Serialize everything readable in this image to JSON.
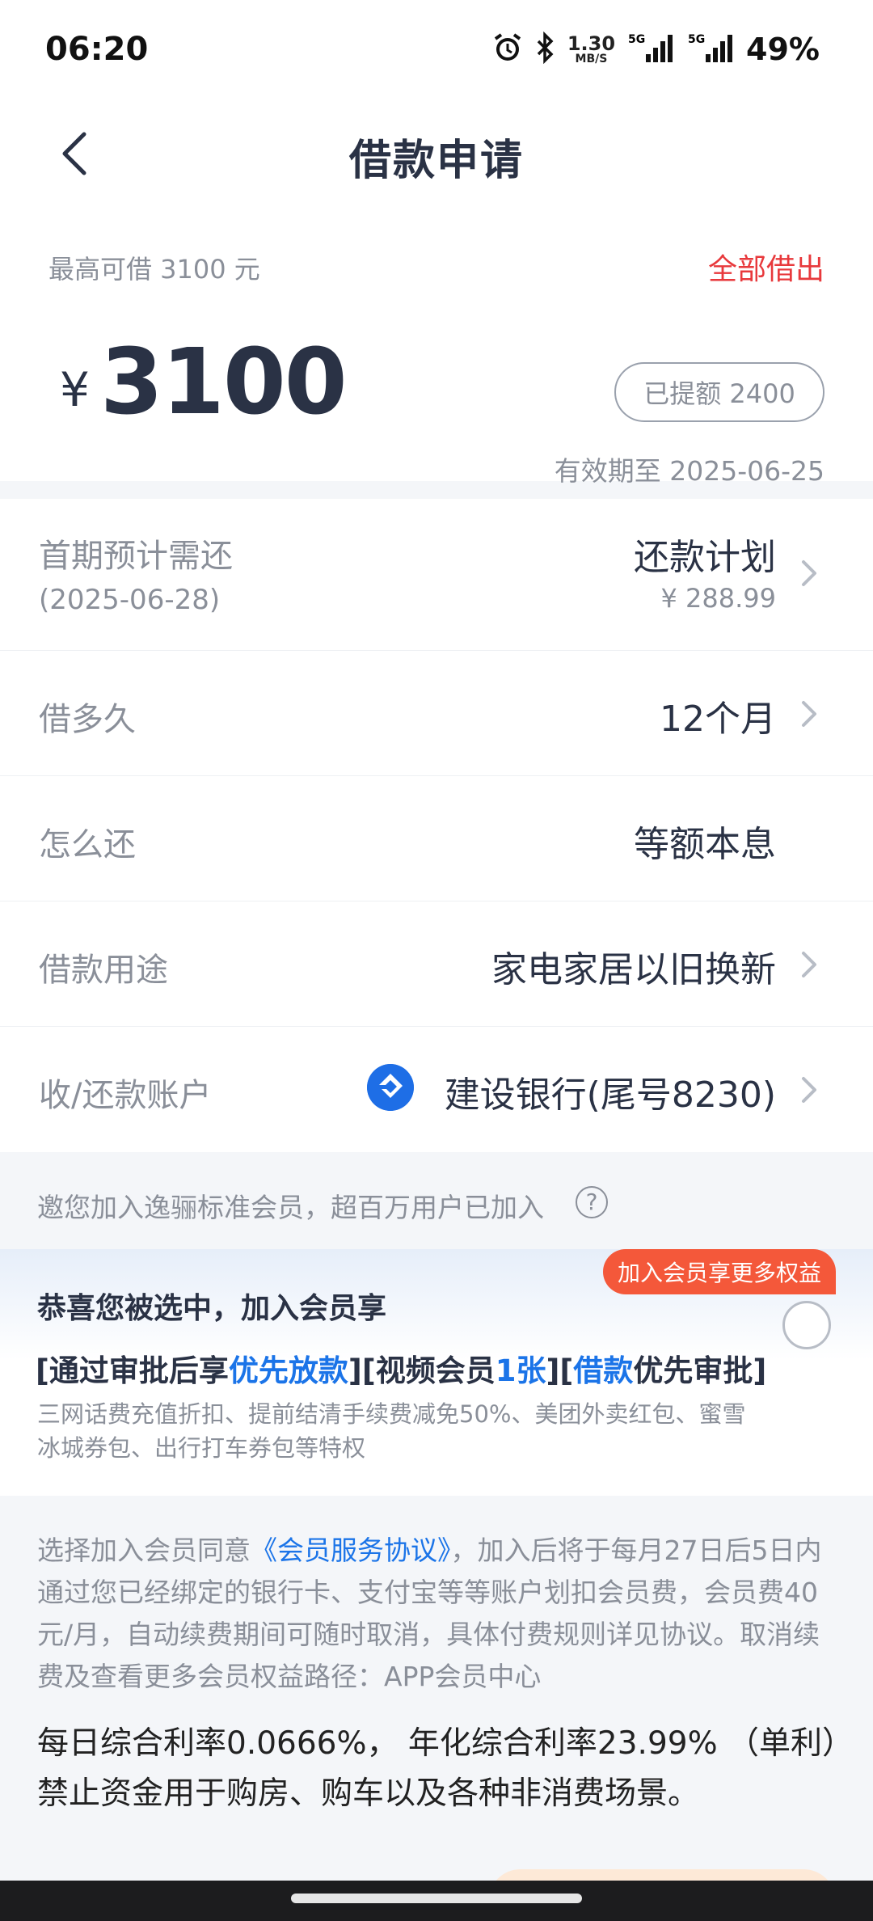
{
  "status_bar": {
    "time": "06:20",
    "speed_value": "1.30",
    "speed_unit": "MB/S",
    "network_1": "5G",
    "network_2": "5G",
    "battery": "49%"
  },
  "header": {
    "title": "借款申请",
    "back_icon": "chevron-left-icon"
  },
  "amount_card": {
    "limit_text": "最高可借  3100  元",
    "borrow_all": "全部借出",
    "currency": "¥",
    "amount": "3100",
    "withdrawn": "已提额 2400",
    "valid_until": "有效期至 2025-06-25"
  },
  "rows": {
    "first_repay": {
      "label": "首期预计需还",
      "sublabel": "(2025-06-28)",
      "value": "还款计划",
      "subvalue": "¥ 288.99"
    },
    "term": {
      "label": "借多久",
      "value": "12个月"
    },
    "method": {
      "label": "怎么还",
      "value": "等额本息"
    },
    "purpose": {
      "label": "借款用途",
      "value": "家电家居以旧换新"
    },
    "account": {
      "label": "收/还款账户",
      "value": "建设银行(尾号8230)",
      "bank_icon": "ccb-bank-logo"
    }
  },
  "member": {
    "invite_text": "邀您加入逸骊标准会员，超百万用户已加入",
    "help_icon_text": "?",
    "tag": "加入会员享更多权益",
    "title": "恭喜您被选中，加入会员享",
    "benefit_1_pre": "[通过审批后享",
    "benefit_1_hl": "优先放款",
    "benefit_1_post": "][视频会员",
    "benefit_2_hl": "1张",
    "benefit_2_post": "][",
    "benefit_3_hl": "借款",
    "benefit_3_post": "优先审批]",
    "desc": "三网话费充值折扣、提前结清手续费减免50%、美团外卖红包、蜜雪冰城券包、出行打车券包等特权"
  },
  "agreement": {
    "pre": "选择加入会员同意",
    "link": "《会员服务协议》",
    "post": "，加入后将于每月27日后5日内通过您已经绑定的银行卡、支付宝等等账户划扣会员费，会员费40元/月，自动续费期间可随时取消，具体付费规则详见协议。取消续费及查看更多会员权益路径：APP会员中心",
    "rate": "每日综合利率0.0666%， 年化综合利率23.99% （单利）禁止资金用于购房、购车以及各种非消费场景。"
  }
}
